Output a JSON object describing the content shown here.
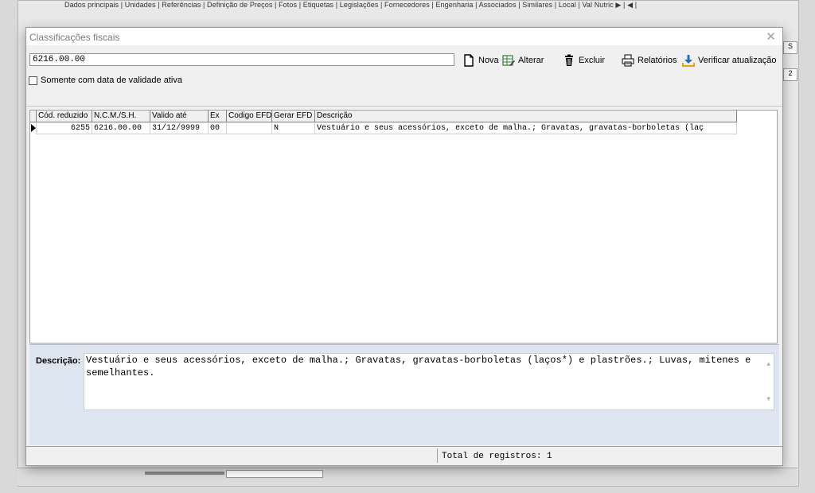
{
  "background": {
    "tabs": "Dados principais | Unidades | Referências | Definição de Preços | Fotos | Etiquetas | Legislações | Fornecedores | Engenharia | Associados | Similares | Local | Val Nutric ▶ | ◀ |",
    "right_box_1": "S",
    "right_box_2": "2"
  },
  "dialog": {
    "title": "Classificações fiscais",
    "close_icon": "close-icon"
  },
  "search": {
    "value": "6216.00.00"
  },
  "toolbar": {
    "nova": "Nova",
    "alterar": "Alterar",
    "excluir": "Excluir",
    "relatorios": "Relatórios",
    "verificar": "Verificar atualização"
  },
  "filter": {
    "label": "Somente com data de validade ativa"
  },
  "grid": {
    "columns": [
      "Cód. reduzido",
      "N.C.M./S.H.",
      "Valido até",
      "Ex",
      "Codigo EFD",
      "Gerar EFD",
      "Descrição"
    ],
    "rows": [
      {
        "cod_reduzido": "6255",
        "ncm": "6216.00.00",
        "valido_ate": "31/12/9999",
        "ex": "00",
        "codigo_efd": "",
        "gerar_efd": "N",
        "descricao": "Vestuário e seus acessórios, exceto de malha.; Gravatas, gravatas-borboletas (laç"
      }
    ]
  },
  "description": {
    "label": "Descrição:",
    "text": "Vestuário e seus acessórios, exceto de malha.; Gravatas, gravatas-borboletas (laços*) e plastrões.; Luvas, mitenes e semelhantes."
  },
  "status": {
    "total": "Total de registros: 1"
  },
  "colors": {
    "desc_panel": "#dde6f0",
    "excel_green": "#2e7d32",
    "download_blue": "#1e6fbf"
  }
}
